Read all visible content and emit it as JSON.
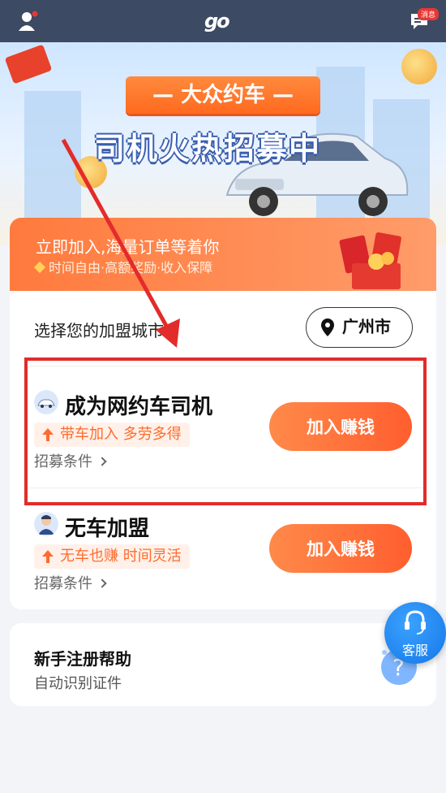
{
  "topbar": {
    "logo_text": "go",
    "message_badge": "消息",
    "icons": {
      "left": "user-icon",
      "right": "message-icon"
    }
  },
  "hero": {
    "banner_title": "— 大众约车 —",
    "banner_subtitle": "司机火热招募中"
  },
  "promo": {
    "title": "立即加入,海量订单等着你",
    "subtitle": "时间自由·高额奖励·收入保障"
  },
  "city": {
    "label": "选择您的加盟城市",
    "selected": "广州市"
  },
  "options": [
    {
      "title": "成为网约车司机",
      "tag": "带车加入 多劳多得",
      "conditions": "招募条件",
      "button": "加入赚钱",
      "icon": "car-icon"
    },
    {
      "title": "无车加盟",
      "tag": "无车也赚 时间灵活",
      "conditions": "招募条件",
      "button": "加入赚钱",
      "icon": "driver-avatar-icon"
    }
  ],
  "help": {
    "title": "新手注册帮助",
    "subtitle": "自动识别证件"
  },
  "service": {
    "label": "客服"
  },
  "colors": {
    "topbar": "#3c4a64",
    "accent": "#ff6b2e",
    "highlight": "#e32b2b",
    "service": "#1677e8"
  }
}
